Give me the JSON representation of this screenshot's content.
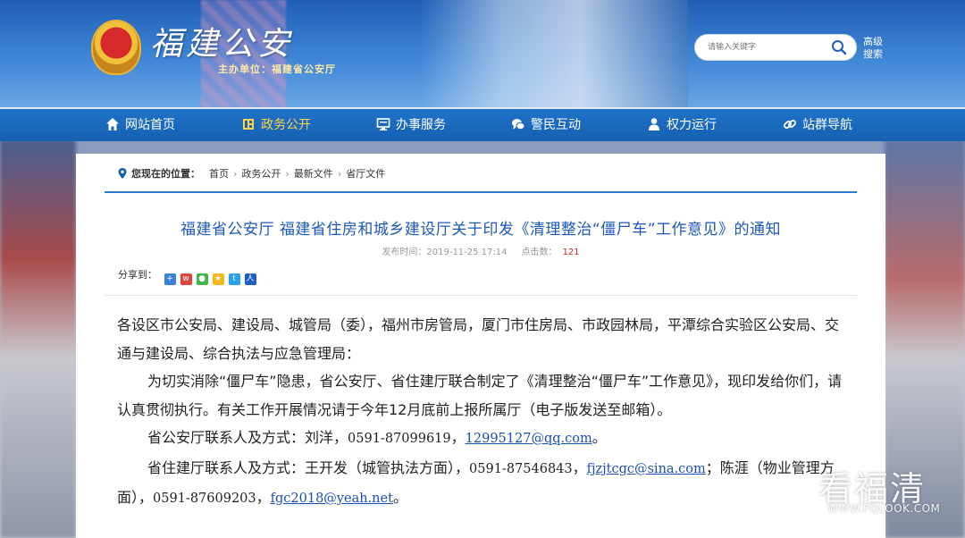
{
  "header": {
    "site_title": "福建公安",
    "host_unit": "主办单位：福建省公安厅",
    "search_placeholder": "请输入关键字",
    "advanced_search": "高级搜索"
  },
  "nav": {
    "items": [
      {
        "label": "网站首页",
        "icon": "home-icon"
      },
      {
        "label": "政务公开",
        "icon": "document-icon",
        "active": true
      },
      {
        "label": "办事服务",
        "icon": "monitor-icon"
      },
      {
        "label": "警民互动",
        "icon": "chat-icon"
      },
      {
        "label": "权力运行",
        "icon": "person-icon"
      },
      {
        "label": "站群导航",
        "icon": "link-icon"
      }
    ]
  },
  "breadcrumb": {
    "label": "您现在的位置：",
    "items": [
      "首页",
      "政务公开",
      "最新文件",
      "省厅文件"
    ]
  },
  "article": {
    "title": "福建省公安厅 福建省住房和城乡建设厅关于印发《清理整治“僵尸车”工作意见》的通知",
    "publish_label": "发布时间：",
    "publish_time": "2019-11-25 17:14",
    "views_label": "点击数：",
    "views": "121",
    "share_label": "分享到：",
    "para1": "各设区市公安局、建设局、城管局（委），福州市房管局，厦门市住房局、市政园林局，平潭综合实验区公安局、交通与建设局、综合执法与应急管理局：",
    "para2": "为切实消除“僵尸车”隐患，省公安厅、省住建厅联合制定了《清理整治“僵尸车”工作意见》，现印发给你们，请认真贯彻执行。有关工作开展情况请于今年12月底前上报所属厅（电子版发送至邮箱）。",
    "contact1_prefix": "省公安厅联系人及方式：刘洋，",
    "contact1_phone": "0591-87099619",
    "contact1_sep": "，",
    "contact1_email": "12995127@qq.com",
    "contact1_end": "。",
    "contact2_prefix": "省住建厅联系人及方式：王开发（城管执法方面），",
    "contact2_phone": "0591-87546843",
    "contact2_sep": "，",
    "contact2_email": "fjzjtcgc@sina.com",
    "contact2_mid": "；陈涯（物业管理方面），",
    "contact2_phone2": "0591-87609203",
    "contact2_sep2": "，",
    "contact2_email2": "fgc2018@yeah.net",
    "contact2_end": "。"
  },
  "watermark": {
    "main": "看福清",
    "sub": "WWW.FQLOOK.COM"
  }
}
